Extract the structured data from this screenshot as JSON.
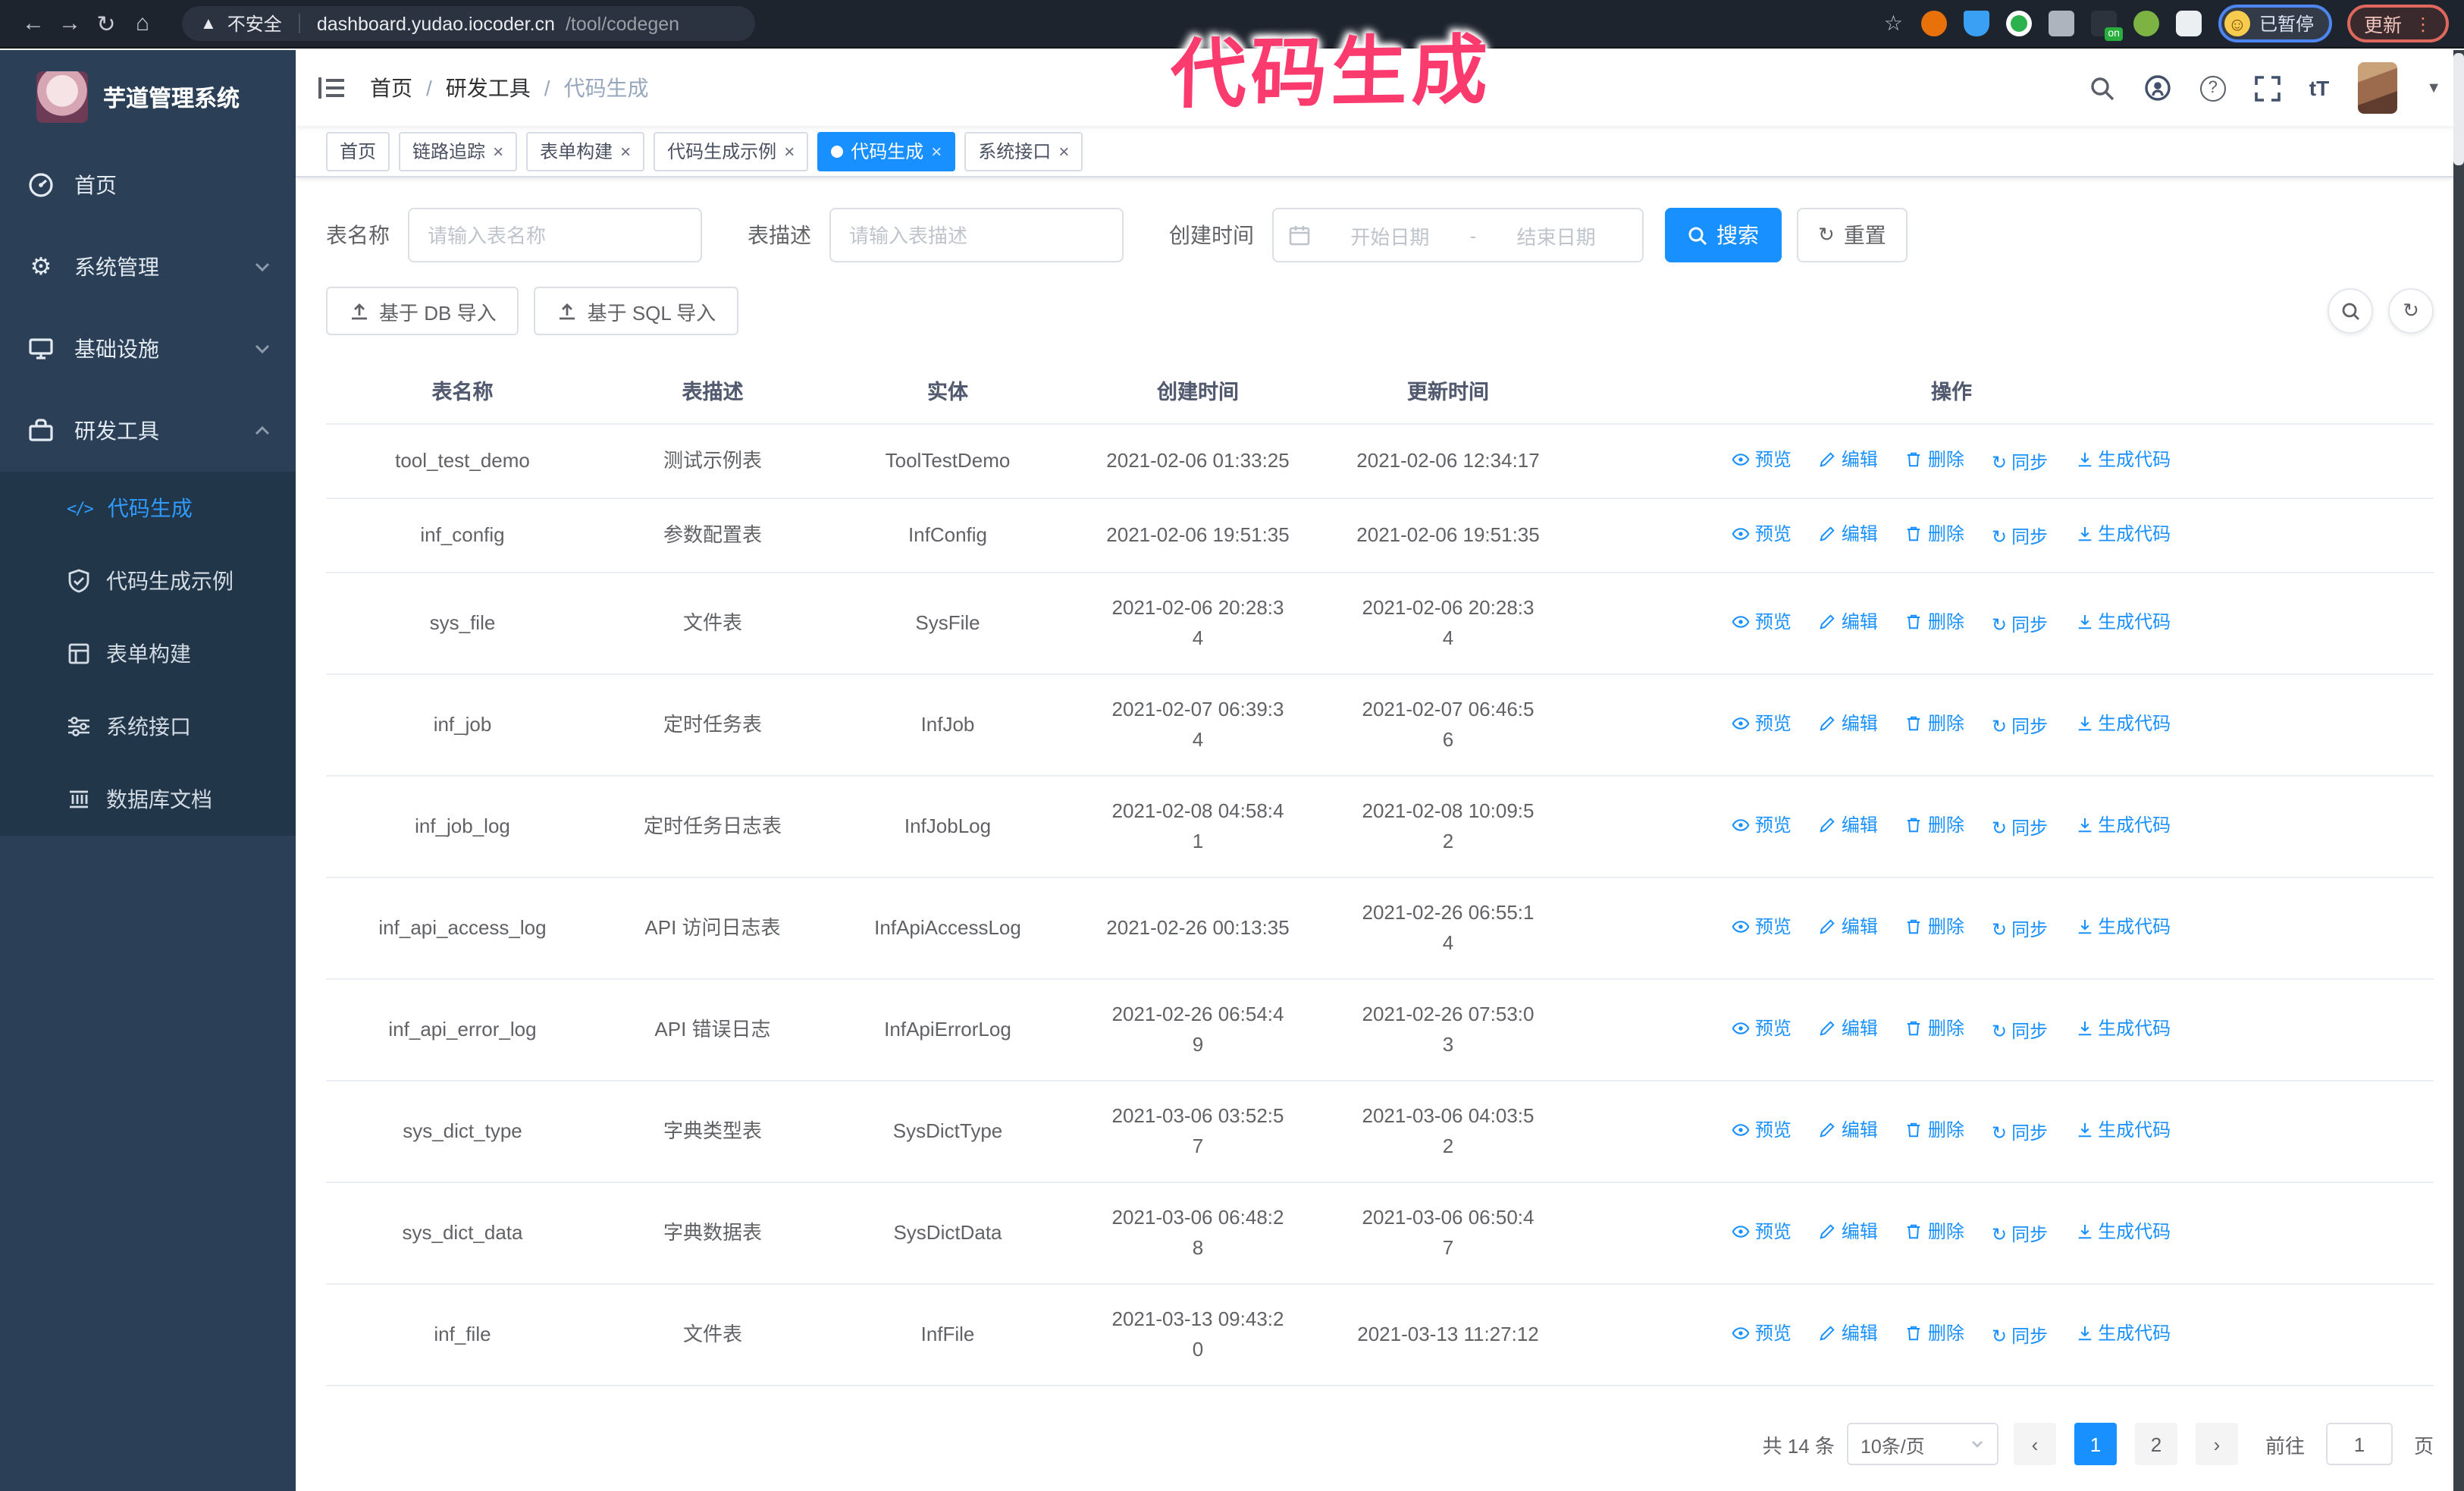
{
  "colors": {
    "accent": "#1890ff",
    "annotation": "#fb3b6e",
    "sidebar_bg": "#2b4057"
  },
  "annotation": {
    "text": "代码生成"
  },
  "browser": {
    "security_label": "不安全",
    "url_host": "dashboard.yudao.iocoder.cn",
    "url_path": "/tool/codegen",
    "extension_badge": "on",
    "profile_badge": "已暂停",
    "update_label": "更新"
  },
  "sidebar": {
    "logo_title": "芋道管理系统",
    "items": [
      {
        "label": "首页"
      },
      {
        "label": "系统管理"
      },
      {
        "label": "基础设施"
      },
      {
        "label": "研发工具"
      }
    ],
    "submenu": [
      {
        "label": "代码生成",
        "active": true
      },
      {
        "label": "代码生成示例"
      },
      {
        "label": "表单构建"
      },
      {
        "label": "系统接口"
      },
      {
        "label": "数据库文档"
      }
    ]
  },
  "header": {
    "breadcrumb": [
      "首页",
      "研发工具",
      "代码生成"
    ]
  },
  "tabs": [
    {
      "label": "首页"
    },
    {
      "label": "链路追踪"
    },
    {
      "label": "表单构建"
    },
    {
      "label": "代码生成示例"
    },
    {
      "label": "代码生成"
    },
    {
      "label": "系统接口"
    }
  ],
  "filters": {
    "table_name_label": "表名称",
    "table_name_placeholder": "请输入表名称",
    "table_desc_label": "表描述",
    "table_desc_placeholder": "请输入表描述",
    "create_time_label": "创建时间",
    "date_start_placeholder": "开始日期",
    "date_separator": "-",
    "date_end_placeholder": "结束日期",
    "search_label": "搜索",
    "reset_label": "重置"
  },
  "toolbar": {
    "import_db": "基于 DB 导入",
    "import_sql": "基于 SQL 导入"
  },
  "table": {
    "columns": [
      "表名称",
      "表描述",
      "实体",
      "创建时间",
      "更新时间",
      "操作"
    ],
    "ops": [
      "预览",
      "编辑",
      "删除",
      "同步",
      "生成代码"
    ],
    "rows": [
      {
        "name": "tool_test_demo",
        "desc": "测试示例表",
        "entity": "ToolTestDemo",
        "created": "2021-02-06 01:33:25",
        "updated": "2021-02-06 12:34:17"
      },
      {
        "name": "inf_config",
        "desc": "参数配置表",
        "entity": "InfConfig",
        "created": "2021-02-06 19:51:35",
        "updated": "2021-02-06 19:51:35"
      },
      {
        "name": "sys_file",
        "desc": "文件表",
        "entity": "SysFile",
        "created": "2021-02-06 20:28:3\n4",
        "updated": "2021-02-06 20:28:3\n4"
      },
      {
        "name": "inf_job",
        "desc": "定时任务表",
        "entity": "InfJob",
        "created": "2021-02-07 06:39:3\n4",
        "updated": "2021-02-07 06:46:5\n6"
      },
      {
        "name": "inf_job_log",
        "desc": "定时任务日志表",
        "entity": "InfJobLog",
        "created": "2021-02-08 04:58:4\n1",
        "updated": "2021-02-08 10:09:5\n2"
      },
      {
        "name": "inf_api_access_log",
        "desc": "API 访问日志表",
        "entity": "InfApiAccessLog",
        "created": "2021-02-26 00:13:35",
        "updated": "2021-02-26 06:55:1\n4"
      },
      {
        "name": "inf_api_error_log",
        "desc": "API 错误日志",
        "entity": "InfApiErrorLog",
        "created": "2021-02-26 06:54:4\n9",
        "updated": "2021-02-26 07:53:0\n3"
      },
      {
        "name": "sys_dict_type",
        "desc": "字典类型表",
        "entity": "SysDictType",
        "created": "2021-03-06 03:52:5\n7",
        "updated": "2021-03-06 04:03:5\n2"
      },
      {
        "name": "sys_dict_data",
        "desc": "字典数据表",
        "entity": "SysDictData",
        "created": "2021-03-06 06:48:2\n8",
        "updated": "2021-03-06 06:50:4\n7"
      },
      {
        "name": "inf_file",
        "desc": "文件表",
        "entity": "InfFile",
        "created": "2021-03-13 09:43:2\n0",
        "updated": "2021-03-13 11:27:12"
      }
    ]
  },
  "pagination": {
    "total": "共 14 条",
    "page_size": "10条/页",
    "pages": [
      "1",
      "2"
    ],
    "active_page": "1",
    "goto_label": "前往",
    "goto_value": "1",
    "page_suffix": "页"
  }
}
